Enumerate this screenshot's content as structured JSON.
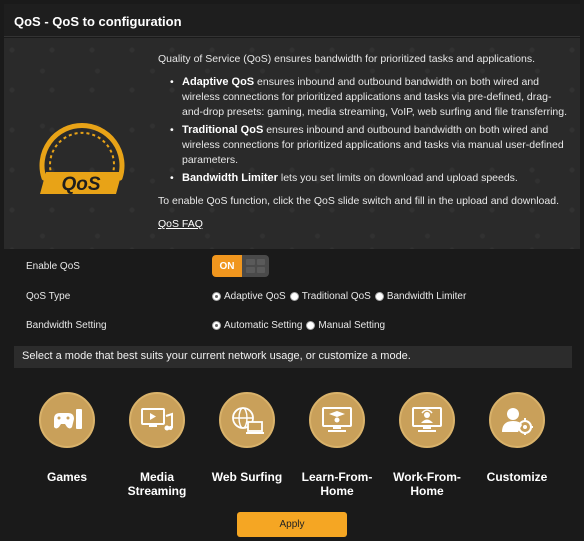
{
  "title": "QoS - QoS to configuration",
  "intro": {
    "lead": "Quality of Service (QoS) ensures bandwidth for prioritized tasks and applications.",
    "bullets": [
      {
        "bold": "Adaptive QoS",
        "text": " ensures inbound and outbound bandwidth on both wired and wireless connections for prioritized applications and tasks via pre-defined, drag-and-drop presets: gaming, media streaming, VoIP, web surfing and file transferring."
      },
      {
        "bold": "Traditional QoS",
        "text": " ensures inbound and outbound bandwidth on both wired and wireless connections for prioritized applications and tasks via manual user-defined parameters."
      },
      {
        "bold": "Bandwidth Limiter",
        "text": " lets you set limits on download and upload speeds."
      }
    ],
    "enable_note": "To enable QoS function, click the QoS slide switch and fill in the upload and download.",
    "faq_link": "QoS FAQ",
    "logo_text": "QoS"
  },
  "settings": {
    "enable_label": "Enable QoS",
    "toggle_on": "ON",
    "type_label": "QoS Type",
    "type_options": [
      "Adaptive QoS",
      "Traditional QoS",
      "Bandwidth Limiter"
    ],
    "type_selected": "Adaptive QoS",
    "bandwidth_label": "Bandwidth Setting",
    "bandwidth_options": [
      "Automatic Setting",
      "Manual Setting"
    ],
    "bandwidth_selected": "Automatic Setting"
  },
  "mode_prompt": "Select a mode that best suits your current network usage, or customize a mode.",
  "modes": [
    {
      "name": "Games",
      "icon": "gamepad-icon"
    },
    {
      "name": "Media Streaming",
      "icon": "media-streaming-icon"
    },
    {
      "name": "Web Surfing",
      "icon": "web-surfing-icon"
    },
    {
      "name": "Learn-From-Home",
      "icon": "learn-from-home-icon"
    },
    {
      "name": "Work-From-Home",
      "icon": "work-from-home-icon"
    },
    {
      "name": "Customize",
      "icon": "customize-icon"
    }
  ],
  "apply_label": "Apply",
  "colors": {
    "accent": "#f5a623",
    "toggle_on": "#f0961e",
    "mode_circle": "#c9a05a",
    "background": "#1a1a1a"
  }
}
